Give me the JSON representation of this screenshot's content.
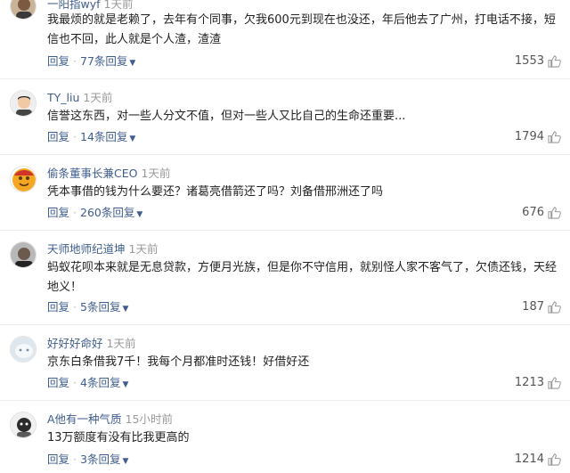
{
  "comments": [
    {
      "username": "一阳指wyf",
      "time": "1天前",
      "text": "我最烦的就是老赖了，去年有个同事，欠我600元到现在也没还，年后他去了广州，打电话不接，短信也不回，此人就是个人渣，渣渣",
      "reply_label": "回复",
      "replies_label": "77条回复",
      "likes": "1553",
      "avatar_icon": "user-avatar-icon"
    },
    {
      "username": "TY_liu",
      "time": "1天前",
      "text": "信誉这东西，对一些人分文不值，但对一些人又比自己的生命还重要...",
      "reply_label": "回复",
      "replies_label": "14条回复",
      "likes": "1794",
      "avatar_icon": "user-avatar-icon"
    },
    {
      "username": "偷条董事长兼CEO",
      "time": "1天前",
      "text": "凭本事借的钱为什么要还？诸葛亮借箭还了吗？刘备借邢洲还了吗",
      "reply_label": "回复",
      "replies_label": "260条回复",
      "likes": "676",
      "avatar_icon": "user-avatar-icon"
    },
    {
      "username": "天师地师纪道坤",
      "time": "1天前",
      "text": "蚂蚁花呗本来就是无息贷款，方便月光族，但是你不守信用，就别怪人家不客气了，欠债还钱，天经地义！",
      "reply_label": "回复",
      "replies_label": "5条回复",
      "likes": "187",
      "avatar_icon": "user-avatar-icon"
    },
    {
      "username": "好好好命好",
      "time": "1天前",
      "text": "京东白条借我7千！我每个月都准时还钱！好借好还",
      "reply_label": "回复",
      "replies_label": "4条回复",
      "likes": "1213",
      "avatar_icon": "user-avatar-icon"
    },
    {
      "username": "A他有一种气质",
      "time": "15小时前",
      "text": "13万额度有没有比我更高的",
      "reply_label": "回复",
      "replies_label": "3条回复",
      "likes": "1214",
      "avatar_icon": "user-avatar-icon"
    }
  ],
  "colors": {
    "username": "#3f5d8e",
    "meta_gray": "#999999",
    "text": "#222222"
  }
}
